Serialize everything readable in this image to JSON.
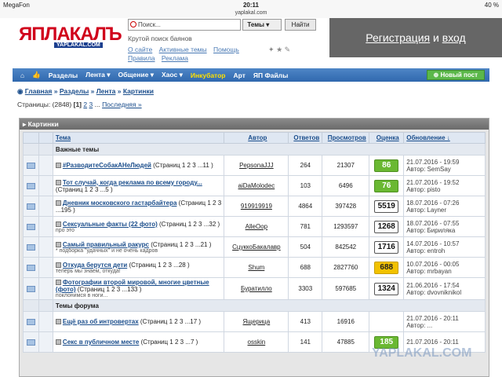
{
  "status": {
    "carrier": "MegaFon",
    "time": "20:11",
    "battery": "40 %",
    "url": "yaplakal.com"
  },
  "header": {
    "logo_text": "ЯПЛАКАЛЪ",
    "logo_sub": "YAPLAKAL.COM",
    "search_placeholder": "Поиск...",
    "search_select": "Темы",
    "search_button": "Найти",
    "tagline": "Крутой поиск баянов",
    "links1": [
      "О сайте",
      "Активные темы",
      "Помощь"
    ],
    "links2": [
      "Правила",
      "Реклама"
    ],
    "register": "Регистрация",
    "and": "и",
    "login": "вход"
  },
  "nav": {
    "items": [
      "Разделы",
      "Лента",
      "Общение",
      "Хаос",
      "Инкубатор",
      "Арт",
      "ЯП Файлы"
    ],
    "new_post": "Новый пост"
  },
  "breadcrumb": [
    "Главная",
    "Разделы",
    "Лента",
    "Картинки"
  ],
  "pagination": {
    "label": "Страницы:",
    "count": "(2848)",
    "current": "[1]",
    "p2": "2",
    "p3": "3",
    "dots": "...",
    "last": "Последняя »"
  },
  "section_title": "Картинки",
  "columns": {
    "topic": "Тема",
    "author": "Автор",
    "replies": "Ответов",
    "views": "Просмотров",
    "score": "Оценка",
    "updated": "Обновление ↓"
  },
  "groups": {
    "important": "Важные темы",
    "forum": "Темы форума"
  },
  "rows": [
    {
      "title": "#РазводитеСобакАНеЛюдей",
      "pages": "(Страниц 1 2 3 ...11 )",
      "note": "",
      "author": "PepsonaJJJ",
      "replies": "264",
      "views": "21307",
      "score": "86",
      "score_color": "green",
      "date": "21.07.2016 - 19:59",
      "last_author": "Автор: SemSay"
    },
    {
      "title": "Тот случай, когда реклама по всему городу...",
      "pages": "(Страниц 1 2 3 ...5 )",
      "note": "",
      "author": "aiDaMolodec",
      "replies": "103",
      "views": "6496",
      "score": "76",
      "score_color": "green",
      "date": "21.07.2016 - 19:52",
      "last_author": "Автор: pisto"
    },
    {
      "title": "Дневник московского гастарбайтера",
      "pages": "(Страниц 1 2 3 ...195 )",
      "note": "",
      "author": "919919919",
      "replies": "4864",
      "views": "397428",
      "score": "5519",
      "score_color": "white",
      "date": "18.07.2016 - 07:26",
      "last_author": "Автор: Layner"
    },
    {
      "title": "Сексуальные факты (22 фото)",
      "pages": "(Страниц 1 2 3 ...32 )",
      "note": "про это",
      "author": "AlleOop",
      "replies": "781",
      "views": "1293597",
      "score": "1268",
      "score_color": "white",
      "date": "18.07.2016 - 07:55",
      "last_author": "Автор: Бириляка"
    },
    {
      "title": "Самый правильный ракурс",
      "pages": "(Страниц 1 2 3 ...21 )",
      "note": "* подборка \"удачных\" и не очень кадров",
      "author": "СцуккоБакалавр",
      "replies": "504",
      "views": "842542",
      "score": "1716",
      "score_color": "white",
      "date": "14.07.2016 - 10:57",
      "last_author": "Автор: entroh"
    },
    {
      "title": "Откуда берутся дети",
      "pages": "(Страниц 1 2 3 ...28 )",
      "note": "теперь мы знаем, откуда!",
      "author": "Shum",
      "replies": "688",
      "views": "2827760",
      "score": "688",
      "score_color": "yellow",
      "date": "10.07.2016 - 00:05",
      "last_author": "Автор: mrbayan"
    },
    {
      "title": "Фотографии второй мировой, многие цветные (фото)",
      "pages": "(Страниц 1 2 3 ...133 )",
      "note": "поклонимся в ноги...",
      "author": "Буратилло",
      "replies": "3303",
      "views": "597685",
      "score": "1324",
      "score_color": "white",
      "date": "21.06.2016 - 17:54",
      "last_author": "Автор: dvovniknikol"
    }
  ],
  "forum_rows": [
    {
      "title": "Ещё раз об интровертах",
      "pages": "(Страниц 1 2 3 ...17 )",
      "author": "Ящерица",
      "replies": "413",
      "views": "16916",
      "score": "",
      "date": "21.07.2016 - 20:11",
      "last_author": "Автор: ..."
    },
    {
      "title": "Секс в публичном месте",
      "pages": "(Страниц 1 2 3 ...7 )",
      "author": "osskin",
      "replies": "141",
      "views": "47885",
      "score": "185",
      "date": "21.07.2016 - 20:11",
      "last_author": ""
    }
  ],
  "watermark": "YAPLAKAL.COM",
  "colors": {
    "nav": "#3a73b8",
    "green": "#6ab832",
    "yellow": "#f2c200",
    "link": "#1b4e8c"
  }
}
